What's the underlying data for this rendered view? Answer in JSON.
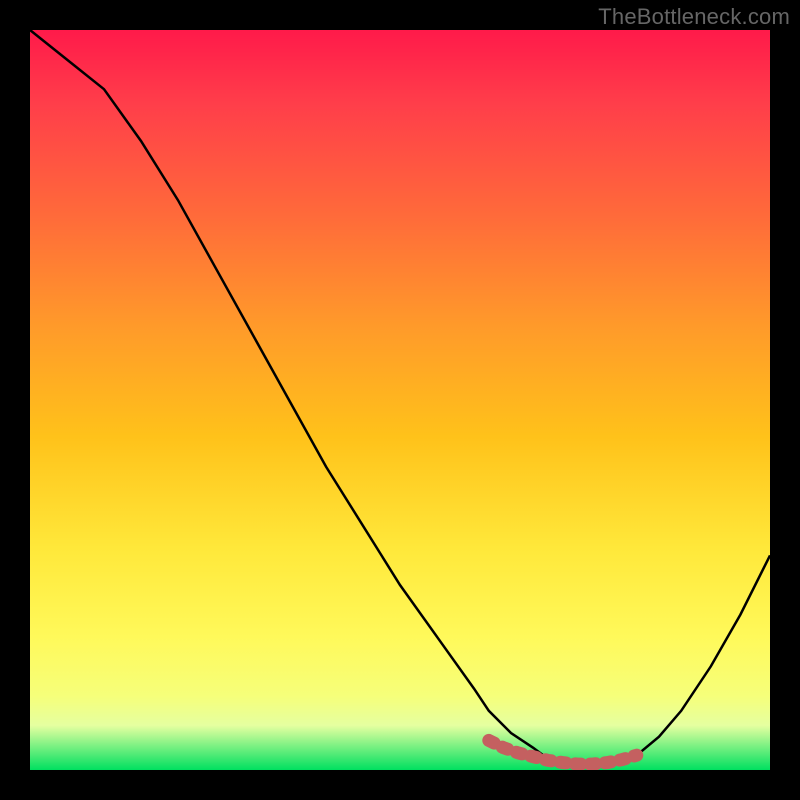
{
  "watermark": "TheBottleneck.com",
  "chart_data": {
    "type": "line",
    "title": "",
    "xlabel": "",
    "ylabel": "",
    "xlim": [
      0,
      100
    ],
    "ylim": [
      0,
      100
    ],
    "series": [
      {
        "name": "bottleneck-curve",
        "x": [
          0,
          5,
          10,
          15,
          20,
          25,
          30,
          35,
          40,
          45,
          50,
          55,
          60,
          62,
          65,
          68,
          70,
          72,
          74,
          76,
          78,
          80,
          82,
          85,
          88,
          92,
          96,
          100
        ],
        "values": [
          100,
          96,
          92,
          85,
          77,
          68,
          59,
          50,
          41,
          33,
          25,
          18,
          11,
          8,
          5,
          3,
          1.5,
          0.8,
          0.5,
          0.4,
          0.5,
          1.0,
          2.0,
          4.5,
          8.0,
          14,
          21,
          29
        ]
      },
      {
        "name": "optimal-range-marker",
        "x": [
          62,
          64,
          66,
          68,
          70,
          72,
          74,
          76,
          78,
          80,
          82
        ],
        "values": [
          4,
          3.0,
          2.3,
          1.8,
          1.3,
          1.0,
          0.8,
          0.8,
          1.0,
          1.4,
          2.0
        ]
      }
    ],
    "annotations": []
  },
  "colors": {
    "curve": "#000000",
    "marker": "#c46060",
    "background_top": "#ff1a4a",
    "background_bottom": "#00e060"
  }
}
